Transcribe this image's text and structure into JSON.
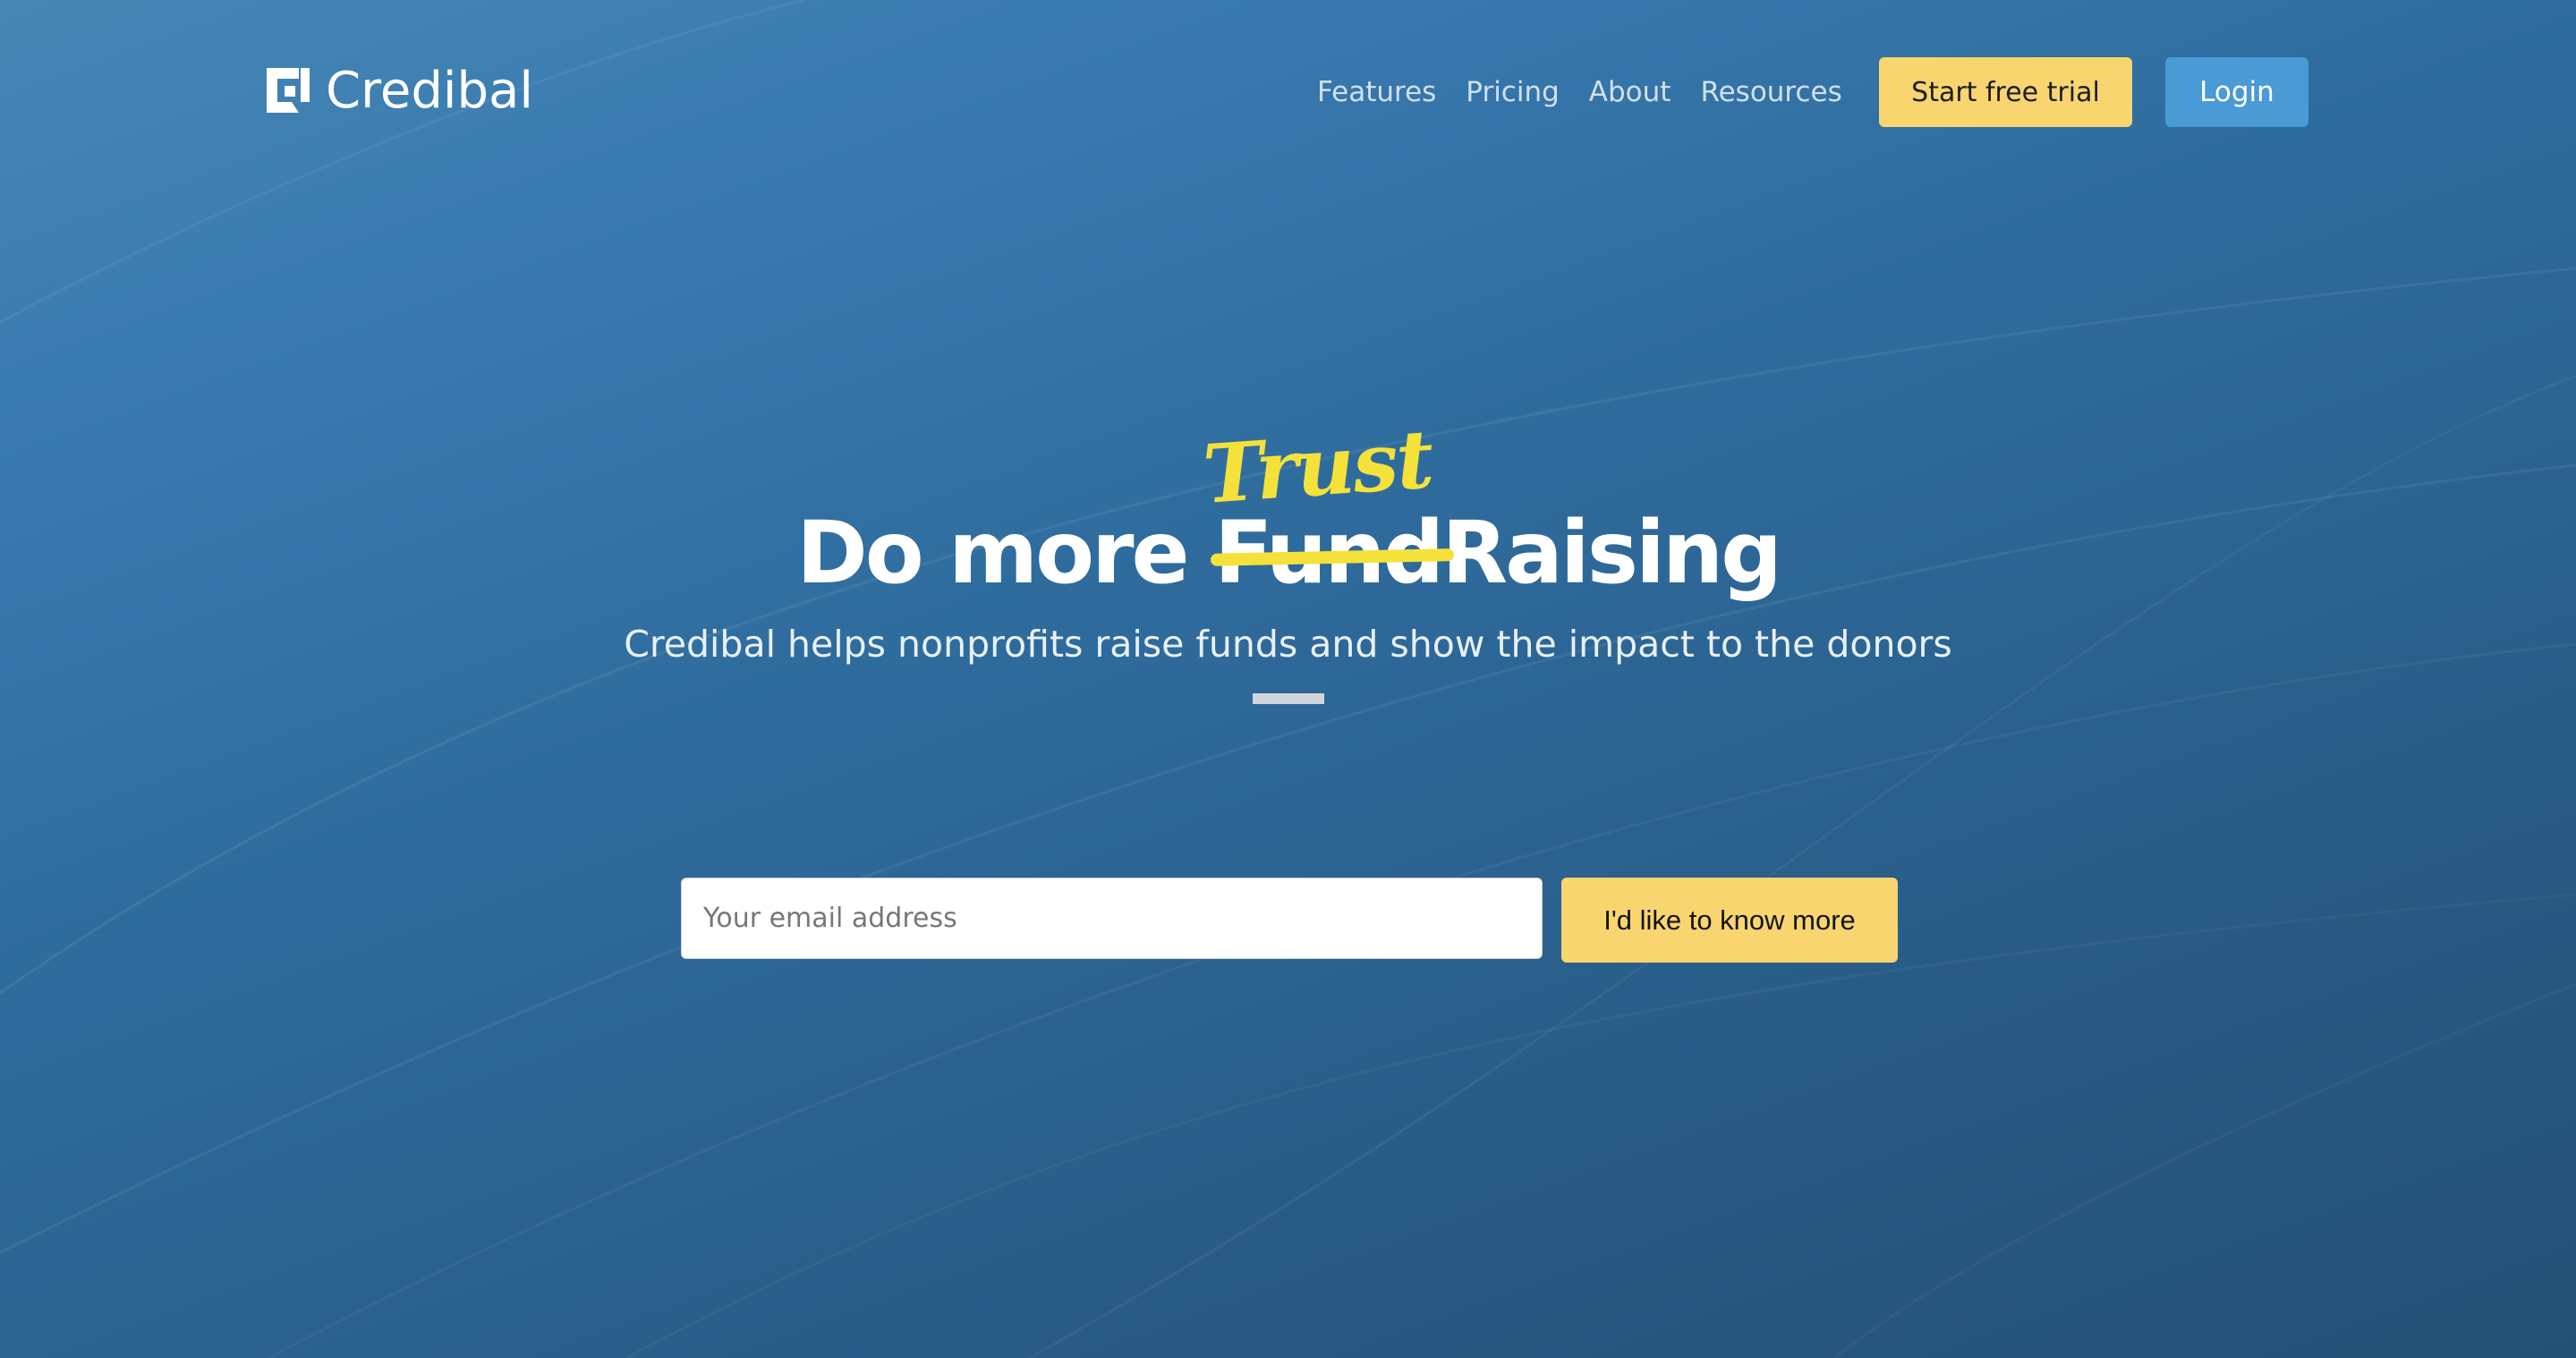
{
  "brand": {
    "name": "Credibal",
    "logo_icon": "credibal-logo-icon"
  },
  "nav": {
    "links": [
      {
        "label": "Features"
      },
      {
        "label": "Pricing"
      },
      {
        "label": "About"
      },
      {
        "label": "Resources"
      }
    ],
    "trial_label": "Start free trial",
    "login_label": "Login"
  },
  "hero": {
    "title_prefix": "Do more ",
    "title_struck": "Fund",
    "title_suffix": "Raising",
    "title_overlay": "Trust",
    "subtitle": "Credibal helps nonprofits raise funds and show the impact to the donors"
  },
  "signup": {
    "email_placeholder": "Your email address",
    "email_value": "",
    "submit_label": "I'd like to know more"
  },
  "colors": {
    "background_top": "#4686b5",
    "background_bottom": "#234f74",
    "accent_yellow": "#f8d56f",
    "highlight_yellow": "#f4e23a",
    "login_blue": "#4a9ad6"
  }
}
